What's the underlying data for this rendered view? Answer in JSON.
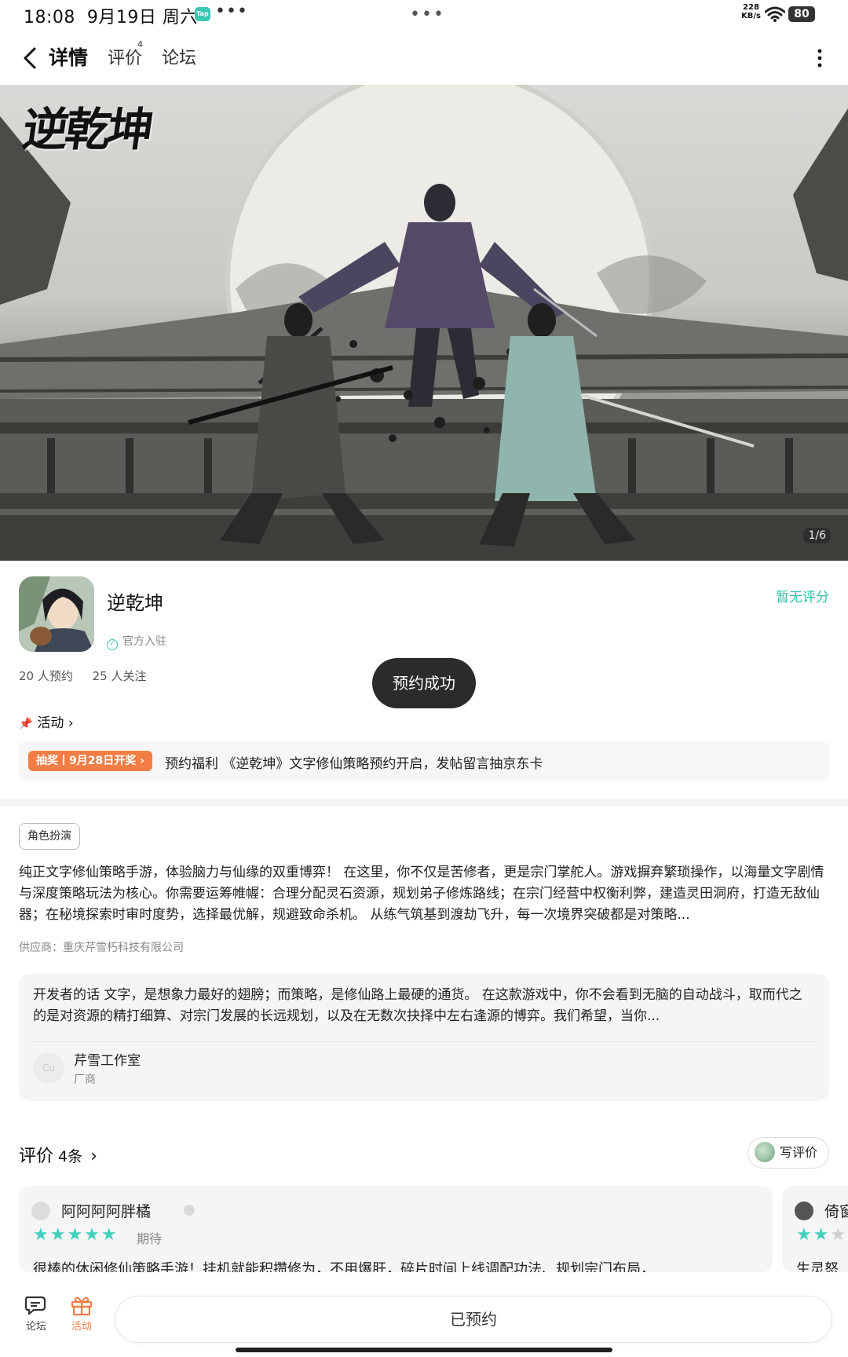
{
  "status": {
    "time": "18:08",
    "date": "9月19日 周六",
    "app_badge": "Tap",
    "more": "•••",
    "center_dots": "•••",
    "speed_value": "228",
    "speed_unit": "KB/s",
    "battery": "80"
  },
  "nav": {
    "tabs": [
      {
        "label": "详情",
        "active": true
      },
      {
        "label": "评价",
        "active": false,
        "superscript": "4"
      },
      {
        "label": "论坛",
        "active": false
      }
    ]
  },
  "banner": {
    "logo_text": "逆乾坤",
    "counter": "1/6"
  },
  "app": {
    "name": "逆乾坤",
    "official": "官方入驻",
    "rating_status": "暂无评分",
    "reservations": "20 人预约",
    "followers": "25 人关注"
  },
  "toast": "预约成功",
  "activity": {
    "header": "活动",
    "tag": "抽奖丨9月28日开奖 ›",
    "text": "预约福利 《逆乾坤》文字修仙策略预约开启，发帖留言抽京东卡"
  },
  "about": {
    "genre": "角色扮演",
    "description": "纯正文字修仙策略手游，体验脑力与仙缘的双重博弈！ 在这里，你不仅是苦修者，更是宗门掌舵人。游戏摒弃繁琐操作，以海量文字剧情与深度策略玩法为核心。你需要运筹帷幄：合理分配灵石资源，规划弟子修炼路线；在宗门经营中权衡利弊，建造灵田洞府，打造无敌仙器；在秘境探索时审时度势，选择最优解，规避致命杀机。 从练气筑基到渡劫飞升，每一次境界突破都是对策略...",
    "supplier": "供应商：重庆芹雪朽科技有限公司"
  },
  "developer": {
    "words": "开发者的话  文字，是想象力最好的翅膀；而策略，是修仙路上最硬的通货。 在这款游戏中，你不会看到无脑的自动战斗，取而代之的是对资源的精打细算、对宗门发展的长远规划，以及在无数次抉择中左右逢源的博弈。我们希望，当你...",
    "avatar_text": "Cu",
    "name": "芹雪工作室",
    "role": "厂商"
  },
  "reviews": {
    "title": "评价",
    "count": "4条",
    "write_label": "写评价",
    "items": [
      {
        "name": "阿阿阿阿胖橘",
        "stars": 5,
        "label": "期待",
        "text": "很棒的休闲修仙策略手游！挂机就能积攒修为，不用爆肝，碎片时间上线调配功法、规划宗门布局，"
      },
      {
        "name": "倚窗",
        "stars": 2,
        "label": "",
        "text": "生灵怒"
      }
    ]
  },
  "bottom": {
    "forum": "论坛",
    "activity": "活动",
    "reserved": "已预约"
  },
  "colors": {
    "accent": "#3ed3c3",
    "rating_teal": "#2fbfa9",
    "activity_orange": "#f27d45"
  }
}
